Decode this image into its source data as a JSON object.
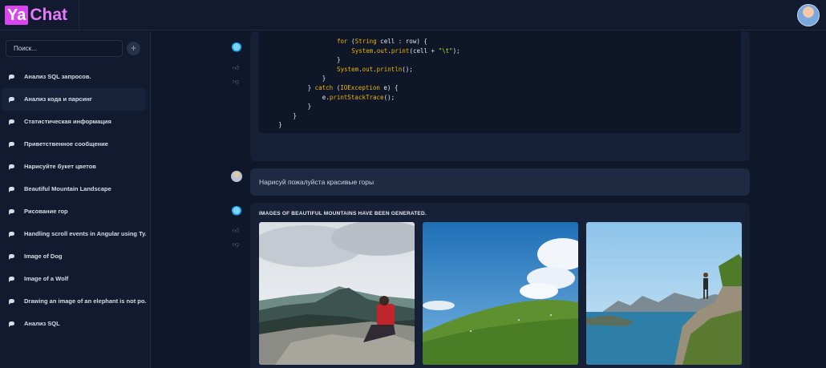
{
  "app": {
    "logo_ya": "Ya",
    "logo_chat": "Chat"
  },
  "sidebar": {
    "search_placeholder": "Поиск...",
    "add_label": "+",
    "items": [
      {
        "label": "Анализ SQL запросов."
      },
      {
        "label": "Анализ кода и парсинг"
      },
      {
        "label": "Статистическая информация"
      },
      {
        "label": "Приветственное сообщение"
      },
      {
        "label": "Нарисуйте букет цветов"
      },
      {
        "label": "Beautiful Mountain Landscape"
      },
      {
        "label": "Рисование гор"
      },
      {
        "label": "Handling scroll events in Angular using Ty..."
      },
      {
        "label": "Image of Dog"
      },
      {
        "label": "Image of a Wolf"
      },
      {
        "label": "Drawing an image of an elephant is not po..."
      },
      {
        "label": "Анализ SQL"
      }
    ],
    "active_index": 1
  },
  "chat": {
    "code_lines": [
      {
        "indent": 10,
        "parts": [
          [
            "kw",
            "for"
          ],
          [
            "txt",
            " ("
          ],
          [
            "kw",
            "String"
          ],
          [
            "txt",
            " cell : row) {"
          ]
        ]
      },
      {
        "indent": 12,
        "parts": [
          [
            "kw",
            "System"
          ],
          [
            "txt",
            "."
          ],
          [
            "kw",
            "out"
          ],
          [
            "txt",
            "."
          ],
          [
            "kw",
            "print"
          ],
          [
            "txt",
            "(cell + "
          ],
          [
            "str",
            "\"\\t\""
          ],
          [
            "txt",
            ");"
          ]
        ]
      },
      {
        "indent": 10,
        "parts": [
          [
            "txt",
            "}"
          ]
        ]
      },
      {
        "indent": 10,
        "parts": [
          [
            "kw",
            "System"
          ],
          [
            "txt",
            "."
          ],
          [
            "kw",
            "out"
          ],
          [
            "txt",
            "."
          ],
          [
            "kw",
            "println"
          ],
          [
            "txt",
            "();"
          ]
        ]
      },
      {
        "indent": 8,
        "parts": [
          [
            "txt",
            "}"
          ]
        ]
      },
      {
        "indent": 6,
        "parts": [
          [
            "txt",
            "} "
          ],
          [
            "kw",
            "catch"
          ],
          [
            "txt",
            " ("
          ],
          [
            "kw",
            "IOException"
          ],
          [
            "txt",
            " e) {"
          ]
        ]
      },
      {
        "indent": 8,
        "parts": [
          [
            "txt",
            "e."
          ],
          [
            "kw",
            "printStackTrace"
          ],
          [
            "txt",
            "();"
          ]
        ]
      },
      {
        "indent": 6,
        "parts": [
          [
            "txt",
            "}"
          ]
        ]
      },
      {
        "indent": 4,
        "parts": [
          [
            "txt",
            "}"
          ]
        ]
      },
      {
        "indent": 2,
        "parts": [
          [
            "txt",
            "}"
          ]
        ]
      }
    ],
    "user_message": "Нарисуй пожалуйста красивые горы",
    "bot_caption": "IMAGES OF BEAUTIFUL MOUNTAINS HAVE BEEN GENERATED."
  },
  "icons": {
    "thumb_up": "thumb-up-icon",
    "thumb_down": "thumb-down-icon",
    "chat": "chat-bubble-icon"
  },
  "colors": {
    "accent": "#d946ef",
    "background": "#0f172a",
    "panel": "#162036"
  }
}
